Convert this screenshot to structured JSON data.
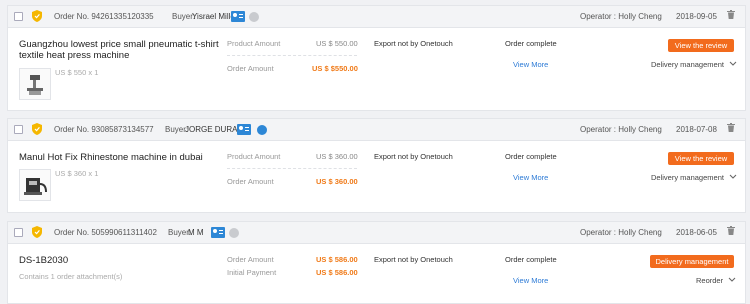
{
  "orders": [
    {
      "order_no": "Order No. 94261335120335",
      "buyer_label": "Buyer:",
      "buyer": "Yisrael Miller",
      "operator": "Operator : Holly Cheng",
      "date": "2018-09-05",
      "title_line1": "Guangzhou lowest price small pneumatic t-shirt",
      "title_line2": "textile heat press machine",
      "price_line": "US $ 550 x 1",
      "row1_label": "Product Amount",
      "row1_value": "US $ 550.00",
      "row2_label": "Order Amount",
      "row2_value": "US $ $550.00",
      "export_status": "Export not by Onetouch",
      "order_status": "Order complete",
      "view_more": "View More",
      "primary_button": "View the review",
      "secondary_action": "Delivery management",
      "status_dot_color": "#c9cbcf"
    },
    {
      "order_no": "Order No. 93085873134577",
      "buyer_label": "Buyer:",
      "buyer": "JORGE DURAN",
      "operator": "Operator : Holly Cheng",
      "date": "2018-07-08",
      "title_line1": "Manul Hot Fix Rhinestone machine in dubai",
      "price_line": "US $ 360 x 1",
      "row1_label": "Product Amount",
      "row1_value": "US $ 360.00",
      "row2_label": "Order Amount",
      "row2_value": "US $ 360.00",
      "export_status": "Export not by Onetouch",
      "order_status": "Order complete",
      "view_more": "View More",
      "primary_button": "View the review",
      "secondary_action": "Delivery management",
      "status_dot_color": "#2d87d6"
    },
    {
      "order_no": "Order No. 505990611311402",
      "buyer_label": "Buyer:",
      "buyer": "M M",
      "operator": "Operator : Holly Cheng",
      "date": "2018-06-05",
      "title_line1": "DS-1B2030",
      "attachment": "Contains 1 order attachment(s)",
      "row1_label": "Order Amount",
      "row1_value": "US $ 586.00",
      "row2_label": "Initial Payment",
      "row2_value": "US $ 586.00",
      "export_status": "Export not by Onetouch",
      "order_status": "Order complete",
      "view_more": "View More",
      "primary_button": "Delivery management",
      "secondary_action": "Reorder",
      "status_dot_color": "#c9cbcf"
    }
  ],
  "colors": {
    "accent_orange": "#f26b1d",
    "link_blue": "#2d7bd6",
    "amount_orange": "#f07a18",
    "shield_yellow": "#f5b700"
  },
  "icons": {
    "shield": "shield-icon",
    "buyer": "buyer-profile-icon",
    "status": "status-dot-icon",
    "trash": "trash-icon",
    "chevron": "chevron-down-icon"
  }
}
